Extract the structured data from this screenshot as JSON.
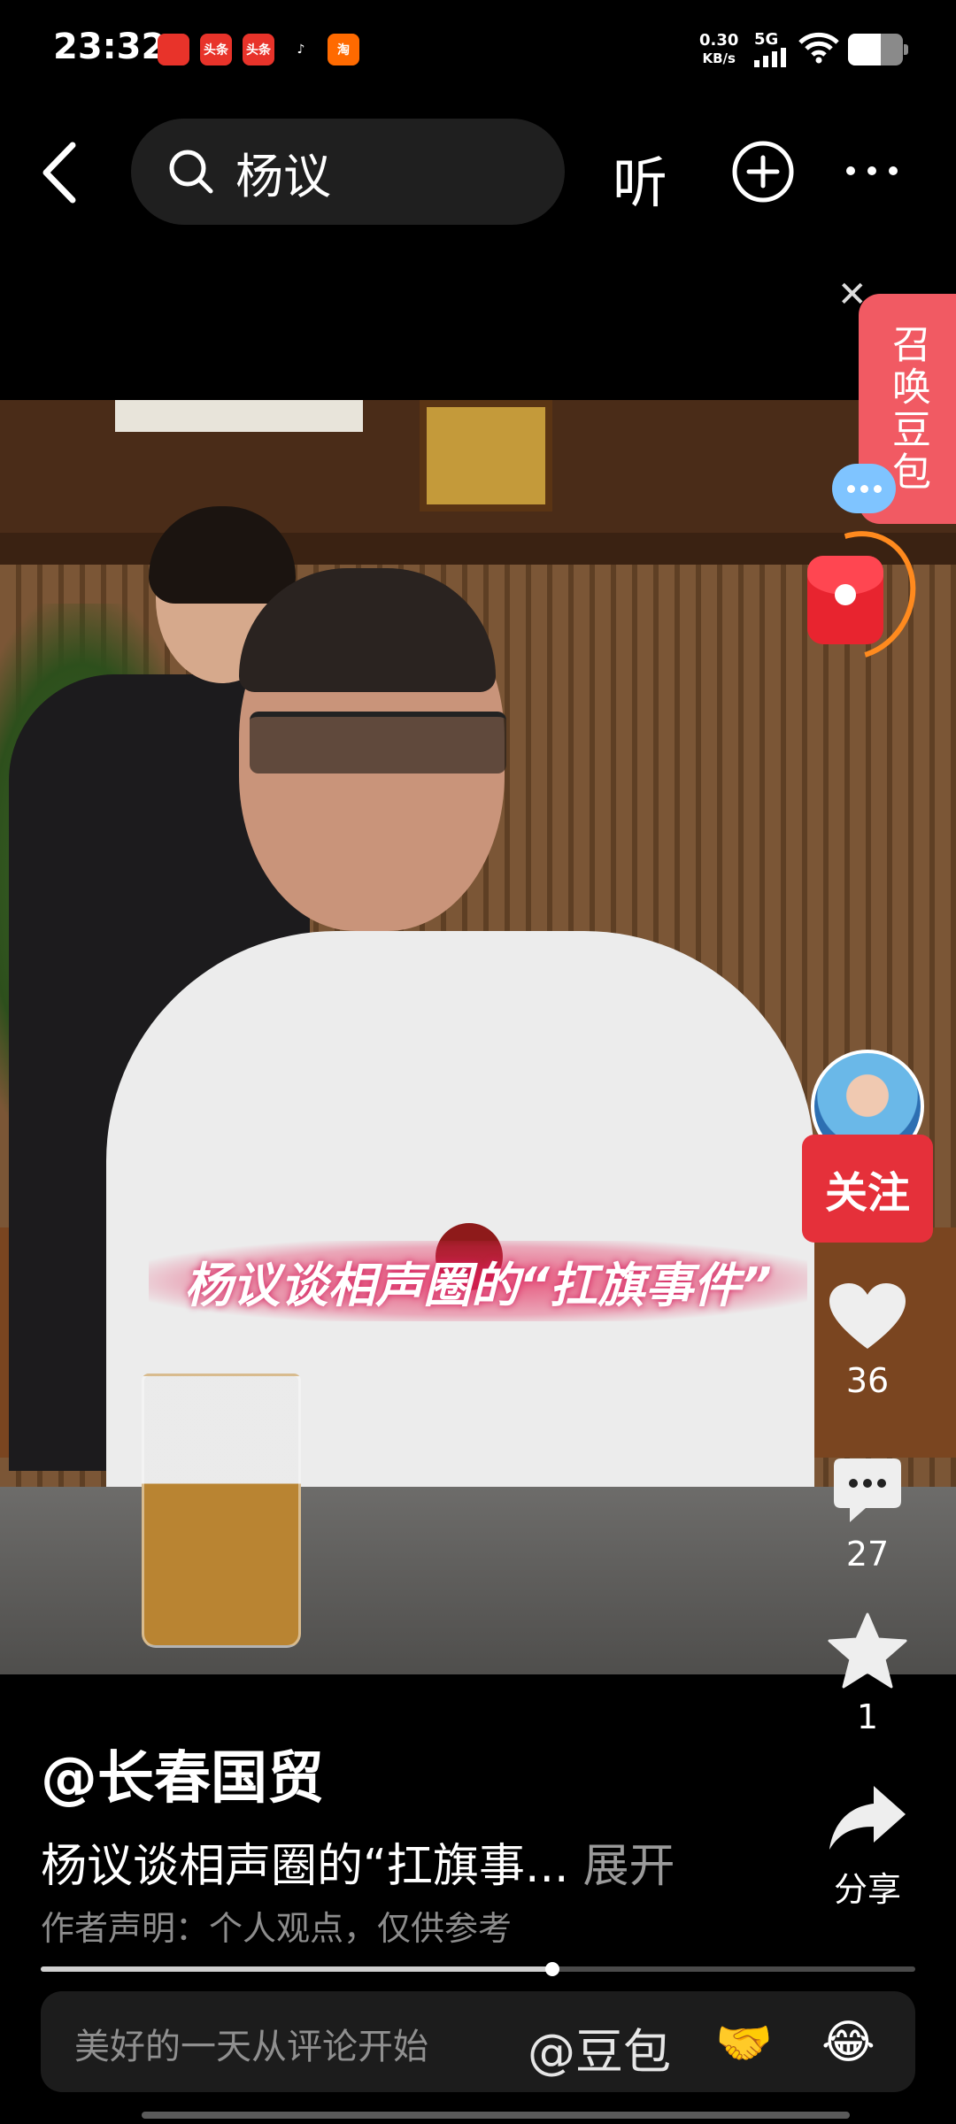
{
  "status_bar": {
    "time": "23:32",
    "notifications": [
      {
        "icon": "app-red-icon",
        "color": "#e8332a",
        "label": ""
      },
      {
        "icon": "toutiao-icon",
        "color": "#e8332a",
        "label": "头条"
      },
      {
        "icon": "toutiao-icon",
        "color": "#e8332a",
        "label": "头条"
      },
      {
        "icon": "tiktok-icon",
        "color": "#000000",
        "label": "♪"
      },
      {
        "icon": "taobao-icon",
        "color": "#ff6a00",
        "label": "淘"
      }
    ],
    "net_speed_value": "0.30",
    "net_speed_unit": "KB/s",
    "network": "5G",
    "battery_level": 0.6
  },
  "top_nav": {
    "search_query": "杨议",
    "listen_label": "听"
  },
  "video": {
    "caption": "杨议谈相声圈的“扛旗事件”"
  },
  "side_panel": {
    "doubao_tab_label": "召唤豆包",
    "follow_label": "关注",
    "like_count": "36",
    "comment_count": "27",
    "favorite_count": "1",
    "share_label": "分享"
  },
  "info": {
    "author": "@长春国贸",
    "description": "杨议谈相声圈的“扛旗事...",
    "expand_label": "展开",
    "statement": "作者声明：个人观点，仅供参考"
  },
  "playback": {
    "progress": 0.585
  },
  "comment_bar": {
    "placeholder": "美好的一天从评论开始",
    "mention": "@豆包",
    "emojis": [
      "🤝",
      "😂"
    ]
  },
  "colors": {
    "accent_red": "#e5303a",
    "doubao_pink": "#f15a63",
    "background": "#000000"
  }
}
